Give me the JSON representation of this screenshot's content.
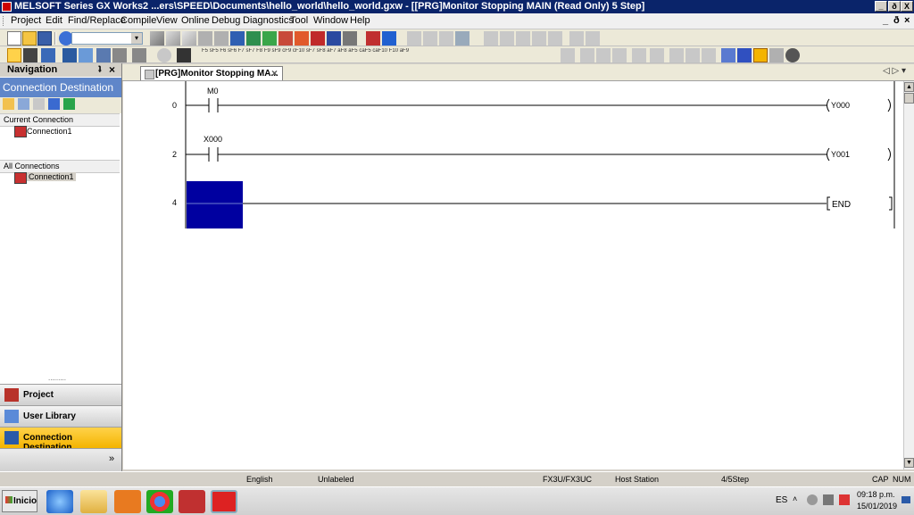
{
  "window": {
    "title": "MELSOFT Series GX Works2 ...ers\\SPEED\\Documents\\hello_world\\hello_world.gxw - [[PRG]Monitor Stopping MAIN (Read Only) 5 Step]",
    "controls": {
      "minimize": "_",
      "restore": "ð",
      "close": "X"
    },
    "child_controls": {
      "minimize": "_",
      "restore": "ð",
      "close": "×"
    }
  },
  "menu": [
    "Project",
    "Edit",
    "Find/Replace",
    "Compile",
    "View",
    "Online",
    "Debug",
    "Diagnostics",
    "Tool",
    "Window",
    "Help"
  ],
  "toolbar": {
    "combo_value": "",
    "ladder_keys": [
      "F5",
      "sF5",
      "F6",
      "sF6",
      "F7",
      "sF7",
      "F8",
      "F9",
      "sF9",
      "cF9",
      "cF10",
      "sF7",
      "sF8",
      "aF7",
      "aF8",
      "aF5",
      "caF5",
      "caF10",
      "F10",
      "aF9"
    ]
  },
  "navigation": {
    "header": "Navigation",
    "pin": "ʇ",
    "close": "×",
    "title": "Connection Destination",
    "current_section": "Current Connection",
    "current_items": [
      "Connection1"
    ],
    "all_section": "All Connections",
    "all_items": [
      "Connection1"
    ],
    "grip": ".........",
    "buttons": [
      {
        "label": "Project",
        "active": false
      },
      {
        "label": "User Library",
        "active": false
      },
      {
        "label": "Connection Destination",
        "active": true
      }
    ],
    "more": "»"
  },
  "editor": {
    "tab_label": "[PRG]Monitor Stopping MA...",
    "tab_close": "×",
    "nav_arrows": "◁ ▷ ▾"
  },
  "ladder": {
    "rungs": [
      {
        "step": "0",
        "contact": "M0",
        "coil": "Y000"
      },
      {
        "step": "2",
        "contact": "X000",
        "coil": "Y001"
      },
      {
        "step": "4",
        "contact": "",
        "coil": "END"
      }
    ]
  },
  "status": {
    "language": "English",
    "label": "Unlabeled",
    "cpu": "FX3U/FX3UC",
    "station": "Host Station",
    "step": "4/5Step",
    "caps": "CAP",
    "num": "NUM"
  },
  "taskbar": {
    "start": "Inicio",
    "lang": "ES",
    "time": "09:18 p.m.",
    "date": "15/01/2019"
  },
  "colors": {
    "selection": "#0000a0",
    "title_bar": "#0a246a",
    "nav_highlight": "#f4b400"
  }
}
